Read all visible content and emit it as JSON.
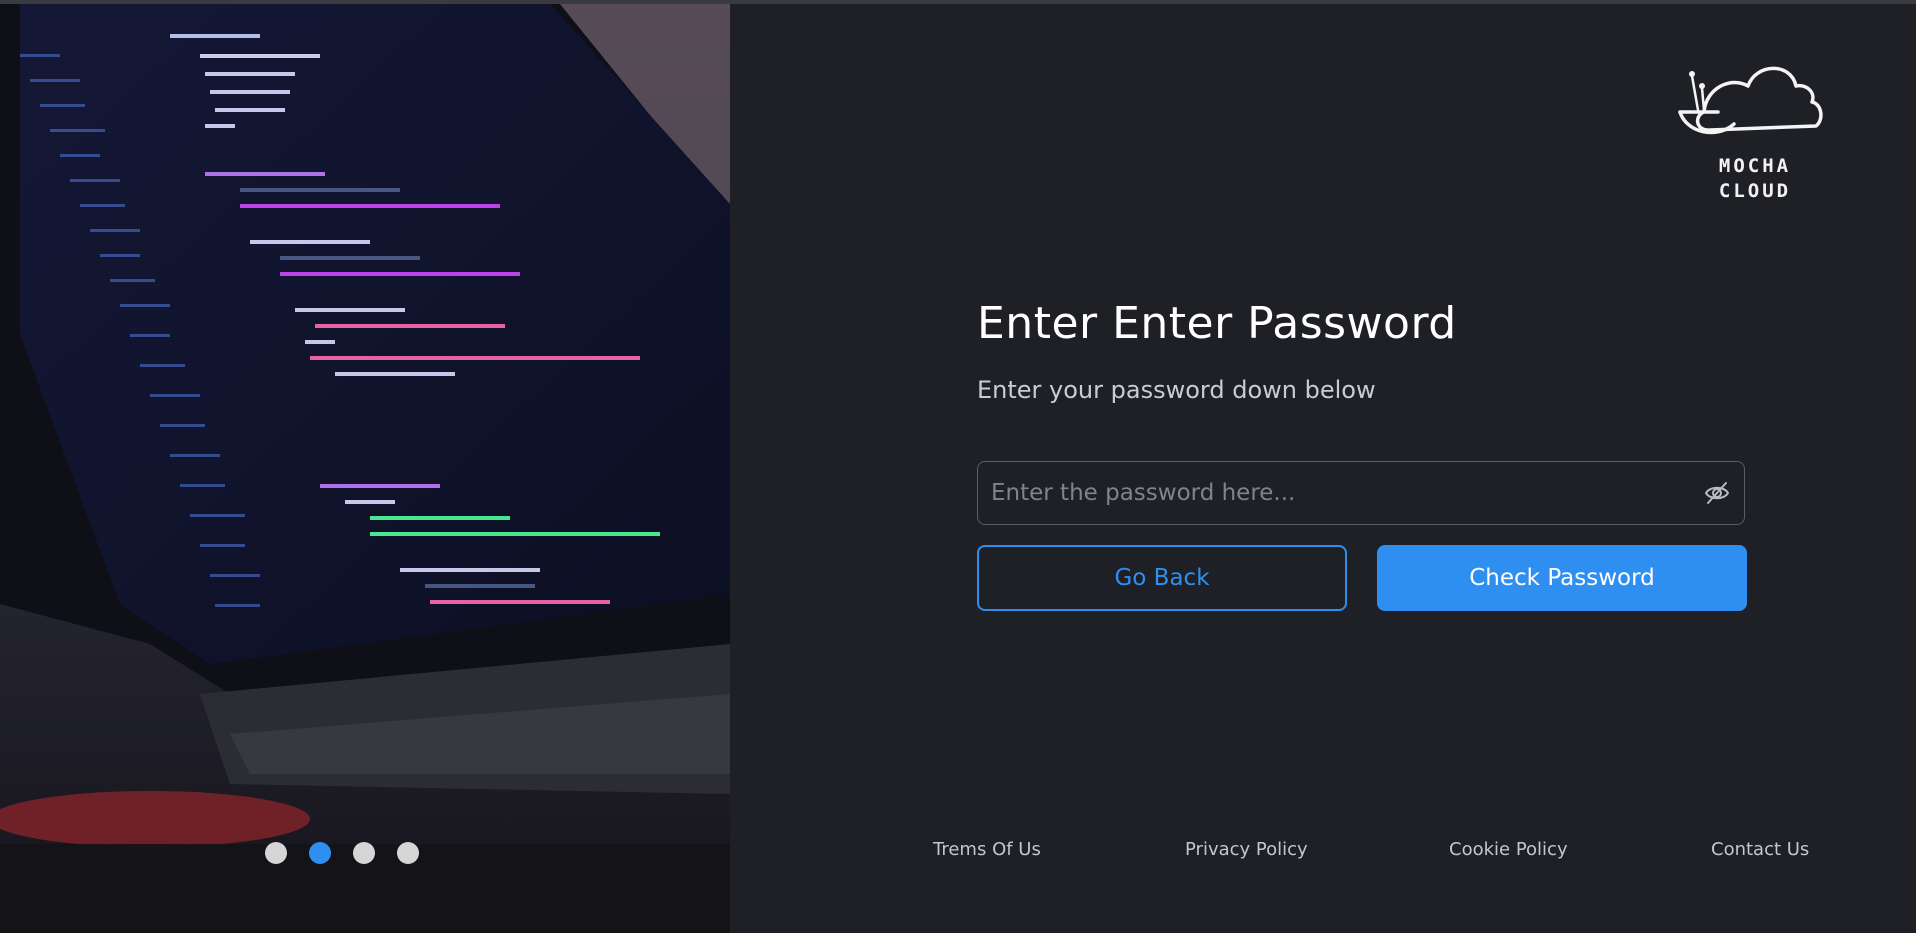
{
  "brand": {
    "name_line1": "MOCHA",
    "name_line2": "CLOUD"
  },
  "main": {
    "title": "Enter Enter Password",
    "subtitle": "Enter your password down below",
    "password_placeholder": "Enter the password here...",
    "password_value": "",
    "visibility_icon": "eye-slash-icon",
    "back_label": "Go Back",
    "check_label": "Check Password"
  },
  "carousel": {
    "slide_count": 4,
    "active_index": 1
  },
  "footer": {
    "links": [
      {
        "label": "Trems Of Us"
      },
      {
        "label": "Privacy Policy"
      },
      {
        "label": "Cookie Policy"
      },
      {
        "label": "Contact Us"
      }
    ]
  },
  "colors": {
    "background": "#1e2026",
    "accent": "#2f8ff0",
    "title": "#ffffff",
    "subtitle": "#c9ccd3"
  }
}
